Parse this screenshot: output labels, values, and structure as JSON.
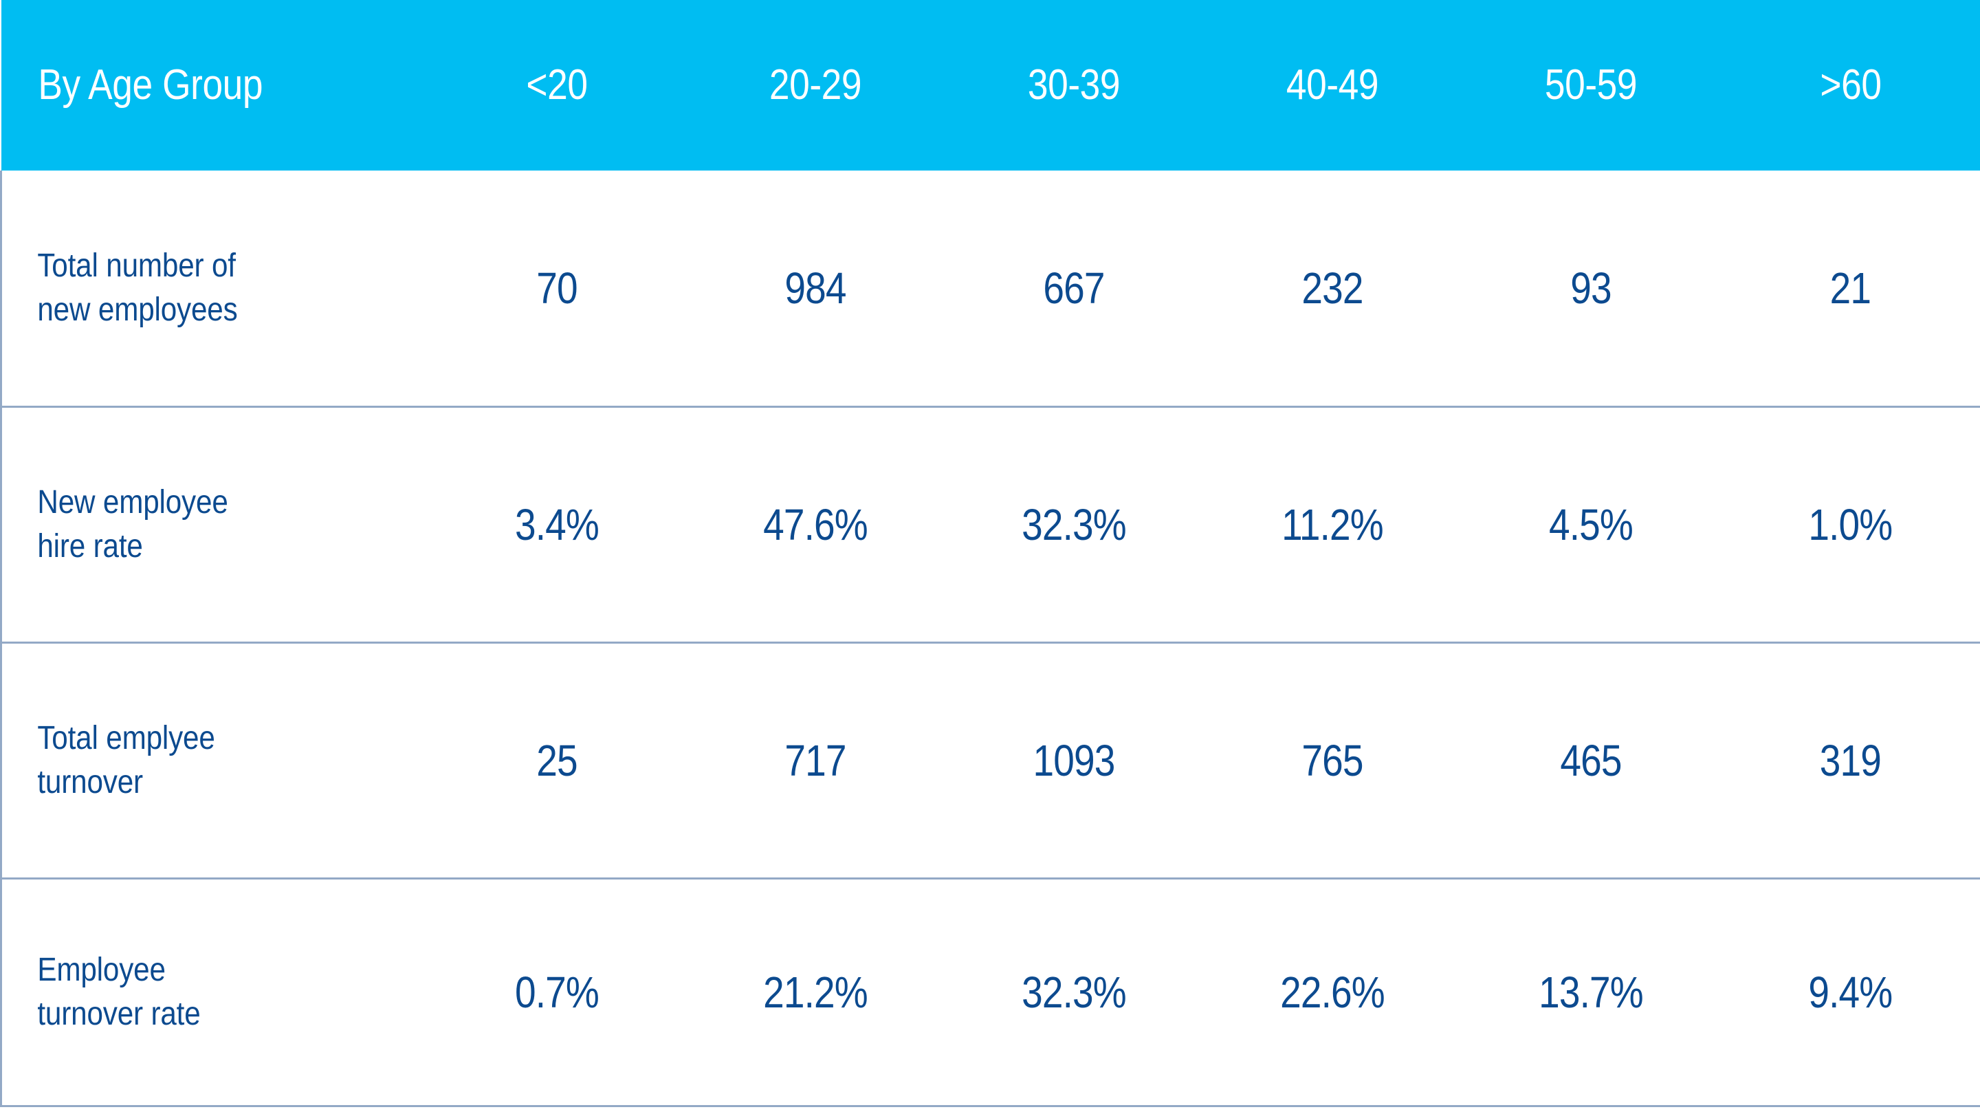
{
  "table": {
    "accent_header_bg": "#00BDF2",
    "header_text_color": "#FFFFFF",
    "body_text_color": "#0C4A8F",
    "divider_color": "#93A9C6",
    "columns": [
      {
        "key": "group",
        "label": "By Age Group"
      },
      {
        "key": "u20",
        "label": "<20"
      },
      {
        "key": "a2029",
        "label": "20-29"
      },
      {
        "key": "a3039",
        "label": "30-39"
      },
      {
        "key": "a4049",
        "label": "40-49"
      },
      {
        "key": "a5059",
        "label": "50-59"
      },
      {
        "key": "o60",
        "label": ">60"
      }
    ],
    "rows": [
      {
        "label_line1": "Total number of",
        "label_line2": "new employees",
        "values": [
          "70",
          "984",
          "667",
          "232",
          "93",
          "21"
        ]
      },
      {
        "label_line1": "New employee",
        "label_line2": "hire rate",
        "values": [
          "3.4%",
          "47.6%",
          "32.3%",
          "11.2%",
          "4.5%",
          "1.0%"
        ]
      },
      {
        "label_line1": "Total emplyee",
        "label_line2": "turnover",
        "values": [
          "25",
          "717",
          "1093",
          "765",
          "465",
          "319"
        ]
      },
      {
        "label_line1": "Employee",
        "label_line2": "turnover rate",
        "values": [
          "0.7%",
          "21.2%",
          "32.3%",
          "22.6%",
          "13.7%",
          "9.4%"
        ]
      }
    ]
  },
  "chart_data": {
    "type": "table",
    "title": "By Age Group",
    "categories": [
      "<20",
      "20-29",
      "30-39",
      "40-49",
      "50-59",
      ">60"
    ],
    "series": [
      {
        "name": "Total number of new employees",
        "values": [
          70,
          984,
          667,
          232,
          93,
          21
        ]
      },
      {
        "name": "New employee hire rate",
        "values": [
          3.4,
          47.6,
          32.3,
          11.2,
          4.5,
          1.0
        ],
        "unit": "%"
      },
      {
        "name": "Total emplyee turnover",
        "values": [
          25,
          717,
          1093,
          765,
          465,
          319
        ]
      },
      {
        "name": "Employee turnover rate",
        "values": [
          0.7,
          21.2,
          32.3,
          22.6,
          13.7,
          9.4
        ],
        "unit": "%"
      }
    ],
    "xlabel": "Age group",
    "ylabel": "",
    "grid": true,
    "legend": "none"
  }
}
